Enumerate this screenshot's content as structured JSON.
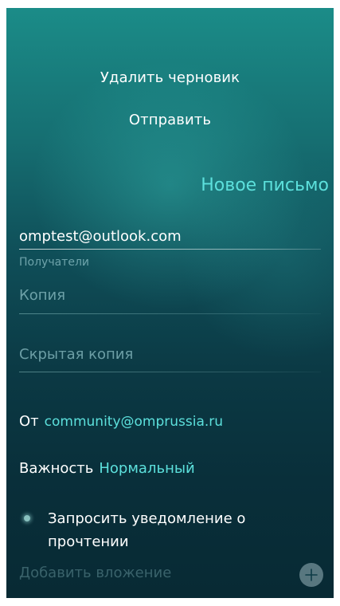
{
  "pulley_menu": {
    "delete_draft": "Удалить черновик",
    "send": "Отправить"
  },
  "header": {
    "title": "Новое письмо"
  },
  "form": {
    "to_value": "omptest@outlook.com",
    "to_label": "Получатели",
    "cc_placeholder": "Копия",
    "bcc_placeholder": "Скрытая копия",
    "from_label": "От",
    "from_value": "community@omprussia.ru",
    "importance_label": "Важность",
    "importance_value": "Нормальный",
    "read_receipt_label": "Запросить уведомление о прочтении",
    "add_attachment_label": "Добавить вложение"
  },
  "icons": {
    "add_attachment": "plus-icon"
  },
  "colors": {
    "accent": "#5ce0dc",
    "secondary_text": "#96c8cd",
    "background_top": "#1b8c88",
    "background_bottom": "#082a34"
  }
}
